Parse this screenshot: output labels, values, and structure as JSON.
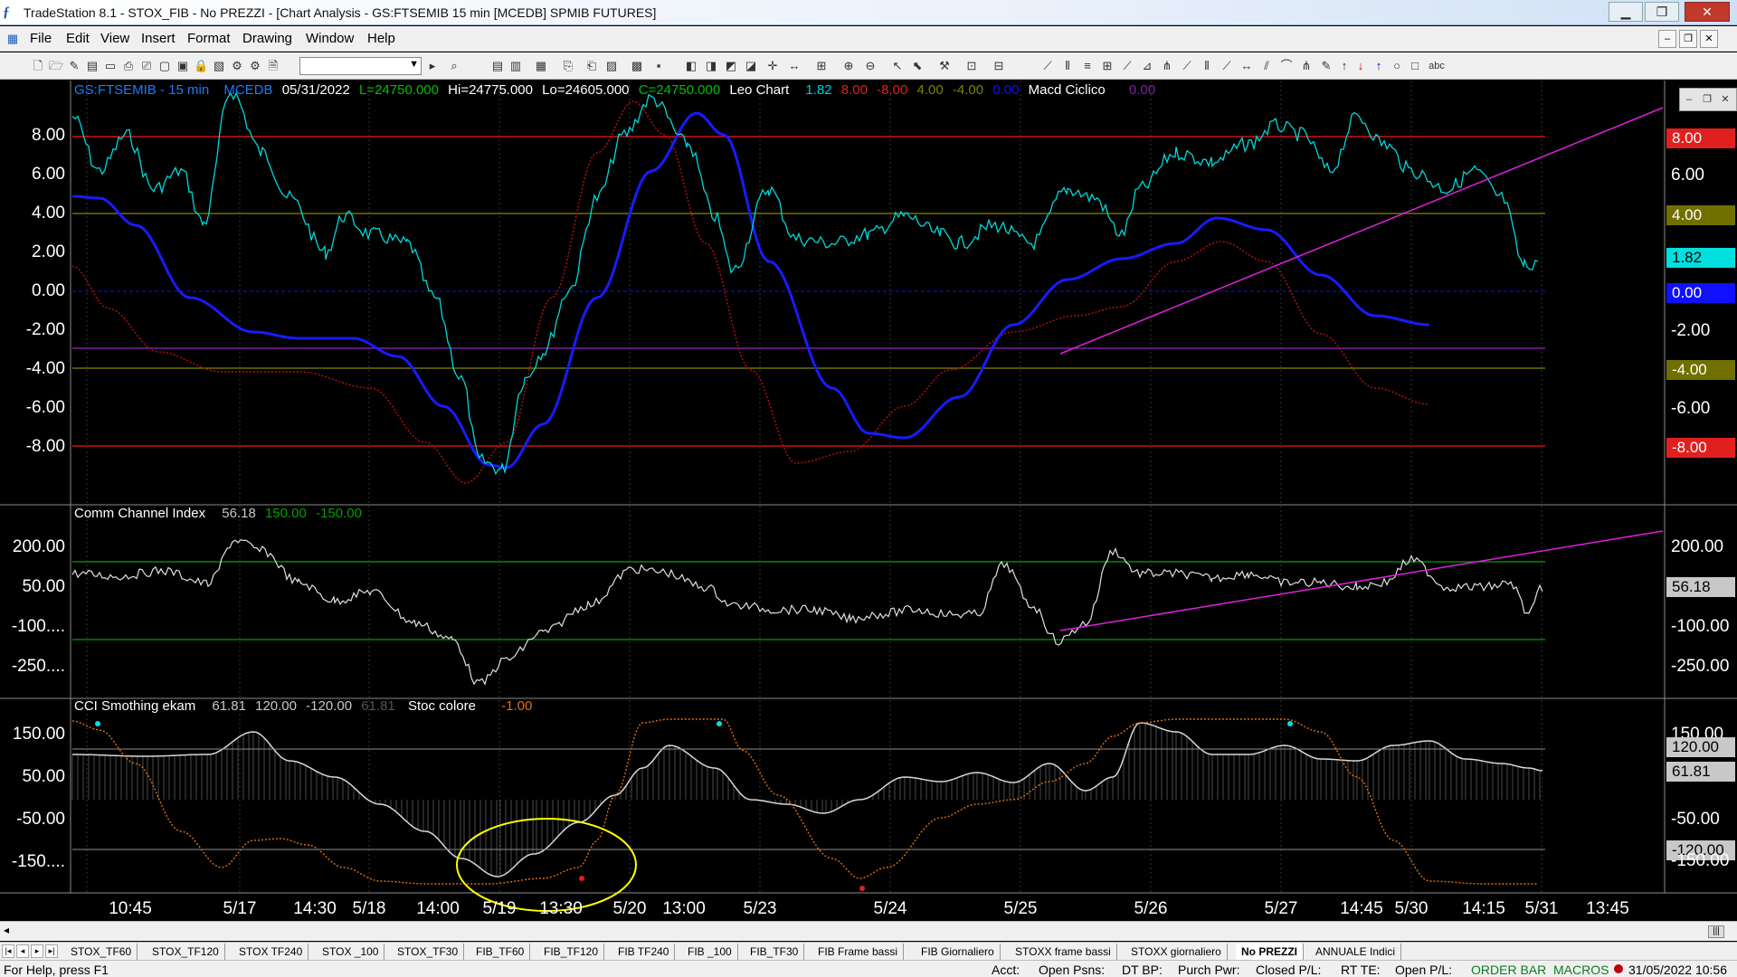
{
  "window": {
    "title": "TradeStation 8.1 - STOX_FIB - No PREZZI - [Chart Analysis - GS:FTSEMIB  15 min  [MCEDB] SPMIB FUTURES]",
    "minimize": "▁",
    "maximize": "❐",
    "close": "✕"
  },
  "menu": [
    "File",
    "Edit",
    "View",
    "Insert",
    "Format",
    "Drawing",
    "Window",
    "Help"
  ],
  "mdi_controls": [
    "‒",
    "❐",
    "✕"
  ],
  "toolbar": {
    "symbol_value": ""
  },
  "panel1": {
    "symbol": "GS:FTSEMIB - 15 min",
    "source": "MCEDB",
    "date": "05/31/2022",
    "last": "L=24750.000",
    "high": "Hi=24775.000",
    "low": "Lo=24605.000",
    "close": "C=24750.000",
    "ind1_name": "Leo Chart",
    "ind1_v1": "1.82",
    "ind1_v2": "8.00",
    "ind1_v3": "-8.00",
    "ind1_v4": "4.00",
    "ind1_v5": "-4.00",
    "ind1_v6": "0.00",
    "ind2_name": "Macd Ciclico",
    "ind2_v1": "0.00",
    "yticks": [
      "8.00",
      "6.00",
      "4.00",
      "2.00",
      "0.00",
      "-2.00",
      "-4.00",
      "-6.00",
      "-8.00"
    ],
    "rticks": [
      "6.00",
      "-2.00",
      "-6.00"
    ],
    "rlabels": [
      {
        "text": "8.00",
        "color": "#e0201e"
      },
      {
        "text": "4.00",
        "color": "#707000"
      },
      {
        "text": "1.82",
        "color": "#00e0e0"
      },
      {
        "text": "0.00",
        "color": "#1010ff"
      },
      {
        "text": "-4.00",
        "color": "#707000"
      },
      {
        "text": "-8.00",
        "color": "#e0201e"
      }
    ]
  },
  "panel2": {
    "name": "Comm Channel Index",
    "v1": "56.18",
    "v2": "150.00",
    "v3": "-150.00",
    "yticks": [
      "200.00",
      "50.00",
      "-100....",
      "-250...."
    ],
    "rticks": [
      "200.00",
      "-100.00",
      "-250.00"
    ],
    "rlabel": "56.18"
  },
  "panel3": {
    "name": "CCI Smothing ekam",
    "v1": "61.81",
    "v2": "120.00",
    "v3": "-120.00",
    "v4": "61.81",
    "stoc_name": "Stoc colore",
    "stoc_v": "-1.00",
    "yticks": [
      "150.00",
      "50.00",
      "-50.00",
      "-150...."
    ],
    "rticks": [
      "150.00",
      "-50.00",
      "-150.00"
    ],
    "rlabels": [
      "120.00",
      "61.81",
      "-120.00"
    ]
  },
  "xaxis": [
    "10:45",
    "5/17",
    "14:30",
    "5/18",
    "14:00",
    "5/19",
    "13:30",
    "5/20",
    "13:00",
    "5/23",
    "5/24",
    "5/25",
    "5/26",
    "5/27",
    "14:45",
    "5/30",
    "14:15",
    "5/31",
    "13:45"
  ],
  "tabs": [
    "STOX_TF60",
    "STOX_TF120",
    "STOX TF240",
    "STOX _100",
    "STOX_TF30",
    "FIB_TF60",
    "FIB_TF120",
    "FIB TF240",
    "FIB _100",
    "FIB_TF30",
    "FIB Frame bassi",
    "FIB Giornaliero",
    "STOXX frame bassi",
    "STOXX giornaliero",
    "No PREZZI",
    "ANNUALE Indici"
  ],
  "active_tab": "No PREZZI",
  "status": {
    "help": "For Help, press F1",
    "acct": "Acct:",
    "open_psns": "Open Psns:",
    "dt_bp": "DT BP:",
    "purch_pwr": "Purch Pwr:",
    "closed_pl": "Closed P/L:",
    "rt_te": "RT TE:",
    "open_pl": "Open P/L:",
    "order_bar": "ORDER BAR",
    "macros": "MACROS",
    "datetime": "31/05/2022 10:56"
  },
  "colors": {
    "cyan": "#00e0e0",
    "blue": "#1a1aff",
    "red": "#d01010",
    "magenta": "#e020e0",
    "olive": "#707000",
    "green": "#00a000",
    "yellow": "#ffff00",
    "orange": "#e07010"
  }
}
